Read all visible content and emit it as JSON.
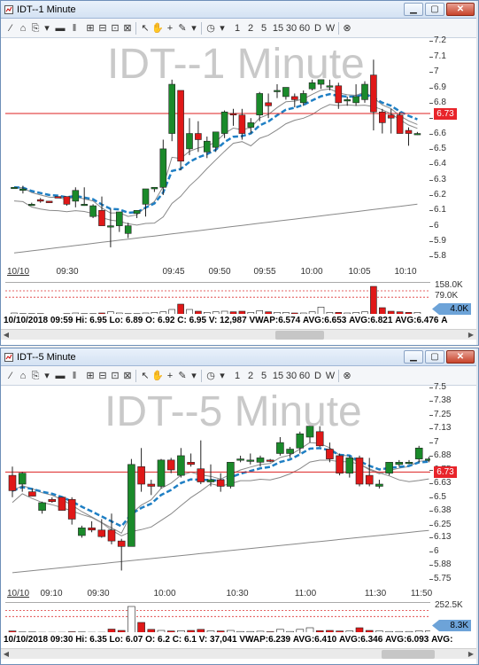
{
  "windows": [
    {
      "title": "IDT--1 Minute",
      "watermark": "IDT--1 Minute",
      "toolbar": {
        "intervals": [
          "1",
          "2",
          "5",
          "15",
          "30",
          "60",
          "D",
          "W"
        ]
      },
      "price_axis": [
        "7.2",
        "7.1",
        "7",
        "6.9",
        "6.8",
        "6.7",
        "6.6",
        "6.5",
        "6.4",
        "6.3",
        "6.2",
        "6.1",
        "6",
        "5.9",
        "5.8"
      ],
      "last_price_tag": "6.73",
      "date_label": "10/10",
      "time_labels": [
        "09:30",
        "09:45",
        "09:50",
        "09:55",
        "10:00",
        "10:05",
        "10:10"
      ],
      "volume_axis": [
        "158.0K",
        "79.0K",
        "0"
      ],
      "volume_tag": "4.0K",
      "status": {
        "datetime": "10/10/2018 09:59",
        "hi": "Hi: 6.95",
        "lo": "Lo: 6.89",
        "open": "O: 6.92",
        "close": "C: 6.95",
        "volume": "V: 12,987",
        "vwap": "VWAP:6.574",
        "avg1": "AVG:6.653",
        "avg2": "AVG:6.821",
        "avg3": "AVG:6.476",
        "avg4": "A"
      },
      "chart_data": {
        "type": "candlestick",
        "title": "IDT--1 Minute",
        "ylim": [
          5.75,
          7.22
        ],
        "candles": [
          {
            "o": 6.25,
            "h": 6.25,
            "l": 6.24,
            "c": 6.25
          },
          {
            "o": 6.23,
            "h": 6.26,
            "l": 6.21,
            "c": 6.24
          },
          {
            "o": 6.14,
            "h": 6.15,
            "l": 6.13,
            "c": 6.14
          },
          {
            "o": 6.17,
            "h": 6.18,
            "l": 6.15,
            "c": 6.16
          },
          {
            "o": 6.16,
            "h": 6.16,
            "l": 6.15,
            "c": 6.15
          },
          {
            "o": 6.19,
            "h": 6.19,
            "l": 6.18,
            "c": 6.18
          },
          {
            "o": 6.19,
            "h": 6.19,
            "l": 6.13,
            "c": 6.14
          },
          {
            "o": 6.16,
            "h": 6.25,
            "l": 6.12,
            "c": 6.23
          },
          {
            "o": 6.14,
            "h": 6.25,
            "l": 6.13,
            "c": 6.14
          },
          {
            "o": 6.06,
            "h": 6.14,
            "l": 6.05,
            "c": 6.13
          },
          {
            "o": 6.1,
            "h": 6.19,
            "l": 6.03,
            "c": 6.0
          },
          {
            "o": 6.0,
            "h": 6.11,
            "l": 5.86,
            "c": 6.0
          },
          {
            "o": 6.0,
            "h": 6.09,
            "l": 5.96,
            "c": 6.09
          },
          {
            "o": 5.95,
            "h": 6.02,
            "l": 5.92,
            "c": 6.0
          },
          {
            "o": 6.08,
            "h": 6.1,
            "l": 6.05,
            "c": 6.1
          },
          {
            "o": 6.14,
            "h": 6.24,
            "l": 6.06,
            "c": 6.24
          },
          {
            "o": 6.24,
            "h": 6.25,
            "l": 6.22,
            "c": 6.25
          },
          {
            "o": 6.25,
            "h": 6.56,
            "l": 6.2,
            "c": 6.5
          },
          {
            "o": 6.6,
            "h": 6.95,
            "l": 6.55,
            "c": 6.92
          },
          {
            "o": 6.88,
            "h": 6.88,
            "l": 6.36,
            "c": 6.42
          },
          {
            "o": 6.5,
            "h": 6.7,
            "l": 6.46,
            "c": 6.6
          },
          {
            "o": 6.6,
            "h": 6.68,
            "l": 6.48,
            "c": 6.56
          },
          {
            "o": 6.48,
            "h": 6.58,
            "l": 6.44,
            "c": 6.55
          },
          {
            "o": 6.51,
            "h": 6.61,
            "l": 6.48,
            "c": 6.61
          },
          {
            "o": 6.6,
            "h": 6.75,
            "l": 6.57,
            "c": 6.74
          },
          {
            "o": 6.73,
            "h": 6.76,
            "l": 6.65,
            "c": 6.72
          },
          {
            "o": 6.72,
            "h": 6.76,
            "l": 6.56,
            "c": 6.6
          },
          {
            "o": 6.64,
            "h": 6.7,
            "l": 6.6,
            "c": 6.67
          },
          {
            "o": 6.72,
            "h": 6.87,
            "l": 6.68,
            "c": 6.86
          },
          {
            "o": 6.8,
            "h": 6.86,
            "l": 6.7,
            "c": 6.78
          },
          {
            "o": 6.88,
            "h": 6.92,
            "l": 6.83,
            "c": 6.88
          },
          {
            "o": 6.84,
            "h": 6.9,
            "l": 6.82,
            "c": 6.9
          },
          {
            "o": 6.84,
            "h": 6.86,
            "l": 6.77,
            "c": 6.82
          },
          {
            "o": 6.8,
            "h": 6.88,
            "l": 6.78,
            "c": 6.86
          },
          {
            "o": 6.89,
            "h": 6.95,
            "l": 6.88,
            "c": 6.93
          },
          {
            "o": 6.92,
            "h": 6.95,
            "l": 6.89,
            "c": 6.95
          },
          {
            "o": 6.91,
            "h": 6.95,
            "l": 6.88,
            "c": 6.91
          },
          {
            "o": 6.91,
            "h": 6.93,
            "l": 6.76,
            "c": 6.8
          },
          {
            "o": 6.82,
            "h": 6.84,
            "l": 6.78,
            "c": 6.82
          },
          {
            "o": 6.8,
            "h": 6.92,
            "l": 6.78,
            "c": 6.84
          },
          {
            "o": 6.82,
            "h": 6.94,
            "l": 6.8,
            "c": 6.92
          },
          {
            "o": 6.98,
            "h": 7.08,
            "l": 6.62,
            "c": 6.74
          },
          {
            "o": 6.74,
            "h": 6.76,
            "l": 6.6,
            "c": 6.67
          },
          {
            "o": 6.72,
            "h": 6.76,
            "l": 6.6,
            "c": 6.7
          },
          {
            "o": 6.72,
            "h": 6.74,
            "l": 6.6,
            "c": 6.6
          },
          {
            "o": 6.62,
            "h": 6.64,
            "l": 6.52,
            "c": 6.6
          },
          {
            "o": 6.6,
            "h": 6.61,
            "l": 6.59,
            "c": 6.6
          }
        ],
        "volume_max": 158000,
        "volumes": [
          3,
          2,
          2,
          2,
          1,
          1,
          2,
          3,
          2,
          2,
          3,
          5,
          3,
          2,
          2,
          3,
          4,
          5,
          9,
          18,
          9,
          6,
          4,
          5,
          6,
          5,
          6,
          4,
          7,
          5,
          4,
          4,
          3,
          3,
          5,
          13,
          4,
          4,
          3,
          4,
          5,
          48,
          12,
          6,
          5,
          4,
          4
        ]
      }
    },
    {
      "title": "IDT--5 Minute",
      "watermark": "IDT--5 Minute",
      "toolbar": {
        "intervals": [
          "1",
          "2",
          "5",
          "15",
          "30",
          "60",
          "D",
          "W"
        ]
      },
      "price_axis": [
        "7.5",
        "7.38",
        "7.25",
        "7.13",
        "7",
        "6.88",
        "6.75",
        "6.63",
        "6.5",
        "6.38",
        "6.25",
        "6.13",
        "6",
        "5.88",
        "5.75"
      ],
      "last_price_tag": "6.73",
      "date_label": "10/10",
      "time_labels": [
        "09:10",
        "09:30",
        "10:00",
        "10:30",
        "11:00",
        "11:30",
        "11:50"
      ],
      "volume_axis": [
        "252.5K",
        "0"
      ],
      "volume_tag": "8.3K",
      "status": {
        "datetime": "10/10/2018 09:30",
        "hi": "Hi: 6.35",
        "lo": "Lo: 6.07",
        "open": "O: 6.2",
        "close": "C: 6.1",
        "volume": "V: 37,041",
        "vwap": "VWAP:6.239",
        "avg1": "AVG:6.410",
        "avg2": "AVG:6.346",
        "avg3": "AVG:6.093",
        "avg4": "AVG:"
      },
      "chart_data": {
        "type": "candlestick",
        "title": "IDT--5 Minute",
        "ylim": [
          5.72,
          7.52
        ],
        "candles": [
          {
            "o": 6.7,
            "h": 6.78,
            "l": 6.5,
            "c": 6.56
          },
          {
            "o": 6.62,
            "h": 6.73,
            "l": 6.55,
            "c": 6.72
          },
          {
            "o": 6.55,
            "h": 6.58,
            "l": 6.51,
            "c": 6.51
          },
          {
            "o": 6.38,
            "h": 6.46,
            "l": 6.35,
            "c": 6.45
          },
          {
            "o": 6.48,
            "h": 6.5,
            "l": 6.45,
            "c": 6.46
          },
          {
            "o": 6.5,
            "h": 6.5,
            "l": 6.38,
            "c": 6.38
          },
          {
            "o": 6.48,
            "h": 6.5,
            "l": 6.25,
            "c": 6.3
          },
          {
            "o": 6.15,
            "h": 6.24,
            "l": 6.13,
            "c": 6.22
          },
          {
            "o": 6.22,
            "h": 6.28,
            "l": 6.18,
            "c": 6.2
          },
          {
            "o": 6.2,
            "h": 6.3,
            "l": 6.13,
            "c": 6.14
          },
          {
            "o": 6.2,
            "h": 6.35,
            "l": 6.07,
            "c": 6.1
          },
          {
            "o": 6.1,
            "h": 6.12,
            "l": 5.83,
            "c": 6.05
          },
          {
            "o": 6.05,
            "h": 6.85,
            "l": 6.05,
            "c": 6.8
          },
          {
            "o": 6.78,
            "h": 6.95,
            "l": 6.55,
            "c": 6.62
          },
          {
            "o": 6.62,
            "h": 6.66,
            "l": 6.52,
            "c": 6.6
          },
          {
            "o": 6.6,
            "h": 6.85,
            "l": 6.58,
            "c": 6.84
          },
          {
            "o": 6.84,
            "h": 6.86,
            "l": 6.72,
            "c": 6.75
          },
          {
            "o": 6.7,
            "h": 6.95,
            "l": 6.68,
            "c": 6.88
          },
          {
            "o": 6.82,
            "h": 6.9,
            "l": 6.78,
            "c": 6.8
          },
          {
            "o": 6.76,
            "h": 7.02,
            "l": 6.62,
            "c": 6.64
          },
          {
            "o": 6.64,
            "h": 6.8,
            "l": 6.6,
            "c": 6.66
          },
          {
            "o": 6.66,
            "h": 6.72,
            "l": 6.55,
            "c": 6.6
          },
          {
            "o": 6.6,
            "h": 6.82,
            "l": 6.58,
            "c": 6.82
          },
          {
            "o": 6.85,
            "h": 6.88,
            "l": 6.82,
            "c": 6.85
          },
          {
            "o": 6.84,
            "h": 6.9,
            "l": 6.8,
            "c": 6.84
          },
          {
            "o": 6.82,
            "h": 6.88,
            "l": 6.78,
            "c": 6.86
          },
          {
            "o": 6.84,
            "h": 6.85,
            "l": 6.82,
            "c": 6.83
          },
          {
            "o": 6.9,
            "h": 7.05,
            "l": 6.88,
            "c": 7.0
          },
          {
            "o": 6.9,
            "h": 6.96,
            "l": 6.86,
            "c": 6.94
          },
          {
            "o": 6.95,
            "h": 7.1,
            "l": 6.9,
            "c": 7.08
          },
          {
            "o": 7.05,
            "h": 7.15,
            "l": 7.0,
            "c": 7.15
          },
          {
            "o": 7.1,
            "h": 7.15,
            "l": 6.96,
            "c": 6.97
          },
          {
            "o": 6.94,
            "h": 7.0,
            "l": 6.82,
            "c": 6.85
          },
          {
            "o": 6.88,
            "h": 6.9,
            "l": 6.7,
            "c": 6.72
          },
          {
            "o": 6.72,
            "h": 6.88,
            "l": 6.68,
            "c": 6.86
          },
          {
            "o": 6.86,
            "h": 6.88,
            "l": 6.6,
            "c": 6.62
          },
          {
            "o": 6.7,
            "h": 6.86,
            "l": 6.6,
            "c": 6.62
          },
          {
            "o": 6.6,
            "h": 6.66,
            "l": 6.58,
            "c": 6.62
          },
          {
            "o": 6.72,
            "h": 6.82,
            "l": 6.7,
            "c": 6.82
          },
          {
            "o": 6.8,
            "h": 6.84,
            "l": 6.78,
            "c": 6.82
          },
          {
            "o": 6.82,
            "h": 6.84,
            "l": 6.8,
            "c": 6.82
          },
          {
            "o": 6.85,
            "h": 6.97,
            "l": 6.82,
            "c": 6.95
          },
          {
            "o": 6.84,
            "h": 6.87,
            "l": 6.82,
            "c": 6.85
          }
        ],
        "volume_max": 252500,
        "volumes": [
          8,
          4,
          4,
          3,
          3,
          3,
          5,
          4,
          3,
          3,
          15,
          10,
          100,
          40,
          14,
          10,
          8,
          9,
          10,
          14,
          8,
          8,
          10,
          6,
          6,
          7,
          5,
          14,
          6,
          14,
          20,
          9,
          10,
          8,
          8,
          20,
          10,
          8,
          6,
          6,
          6,
          8,
          8
        ]
      }
    }
  ]
}
